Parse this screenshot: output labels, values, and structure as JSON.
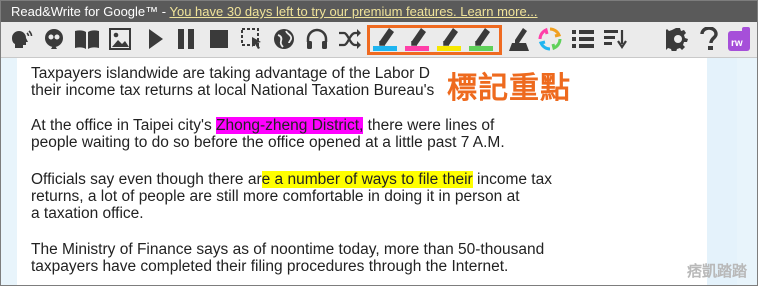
{
  "banner": {
    "app_name": "Read&Write for Google™ - ",
    "promo_link": "You have 30 days left to try our premium features. Learn more..."
  },
  "toolbar": {
    "icons": [
      "text-to-speech-voice-icon",
      "predict-word-icon",
      "dictionary-icon",
      "picture-dictionary-icon",
      "play-icon",
      "pause-icon",
      "stop-icon",
      "screenshot-reader-icon",
      "translator-icon",
      "audio-maker-icon",
      "simplify-page-icon",
      "highlight-blue-icon",
      "highlight-pink-icon",
      "highlight-yellow-icon",
      "highlight-green-icon",
      "clear-highlights-icon",
      "collect-highlights-icon",
      "vocabulary-list-icon",
      "fact-finder-icon",
      "settings-icon",
      "help-icon",
      "rw-logo-icon"
    ],
    "highlight_colors": {
      "blue": "#1fb5f0",
      "pink": "#ff3fa8",
      "yellow": "#f6e700",
      "green": "#5fd15a"
    },
    "highlight_group_border": "#ef6a20"
  },
  "callout": {
    "text": "標記重點"
  },
  "article": {
    "p1": {
      "line1": "Taxpayers islandwide are taking advantage of the Labor D",
      "line2": "their income tax returns at local National Taxation Bureau's"
    },
    "p2": {
      "line1_pre": "At the office in Taipei city's ",
      "line1_highlight": "Zhong-zheng District,",
      "line1_post": " there were lines of",
      "line2": "people waiting to do so before the office opened at a little past 7 A.M."
    },
    "p3": {
      "line1_pre": "Officials say even though there ar",
      "line1_highlight": "e a number of ways to file their",
      "line1_post": " income tax",
      "line2": "returns, a lot of people are still more comfortable in doing it in person at",
      "line3": "a taxation office."
    },
    "p4": {
      "line1": "The Ministry of Finance says as of noontime today, more than 50-thousand",
      "line2": "taxpayers have completed their filing procedures through the Internet."
    }
  },
  "watermark": "痞凱踏踏",
  "colors": {
    "accent_orange": "#ef6a20",
    "highlight_magenta": "#ff00ff",
    "highlight_yellow": "#ffff00",
    "banner_bg": "#5a5a5a"
  }
}
